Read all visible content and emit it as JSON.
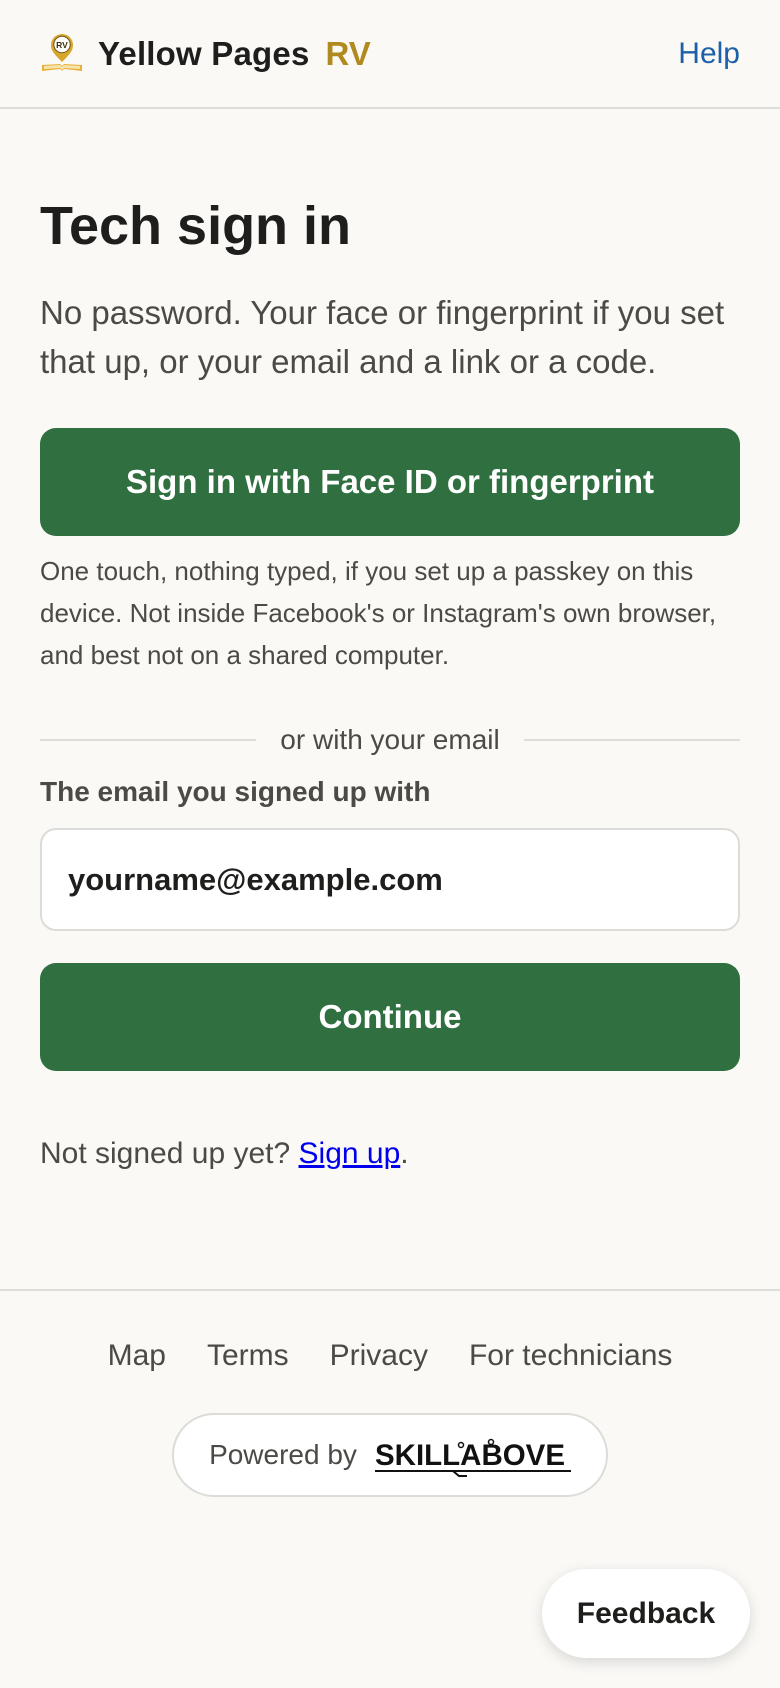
{
  "header": {
    "logo_icon": "rv-map-pin-book-icon",
    "logo_badge_text": "RV",
    "brand_name": "Yellow Pages",
    "brand_suffix": "RV",
    "help_label": "Help"
  },
  "main": {
    "title": "Tech sign in",
    "intro": "No password. Your face or fingerprint if you set that up, or your email and a link or a code.",
    "passkey_button_label": "Sign in with Face ID or fingerprint",
    "passkey_help": "One touch, nothing typed, if you set up a passkey on this device. Not inside Facebook's or Instagram's own browser, and best not on a shared computer.",
    "divider_text": "or with your email",
    "email_label": "The email you signed up with",
    "email_placeholder": "yourname@example.com",
    "email_value": "",
    "continue_label": "Continue",
    "signup_prompt": "Not signed up yet? ",
    "signup_link": "Sign up",
    "signup_suffix": "."
  },
  "footer": {
    "links": [
      "Map",
      "Terms",
      "Privacy",
      "For technicians"
    ],
    "powered_by": "Powered by",
    "sponsor_logo_text": "SKILLABOVE"
  },
  "feedback_label": "Feedback",
  "colors": {
    "primary_green": "#2f6f40",
    "brand_gold": "#b08a1e",
    "link_blue": "#1d5fa8",
    "background": "#faf9f6"
  }
}
